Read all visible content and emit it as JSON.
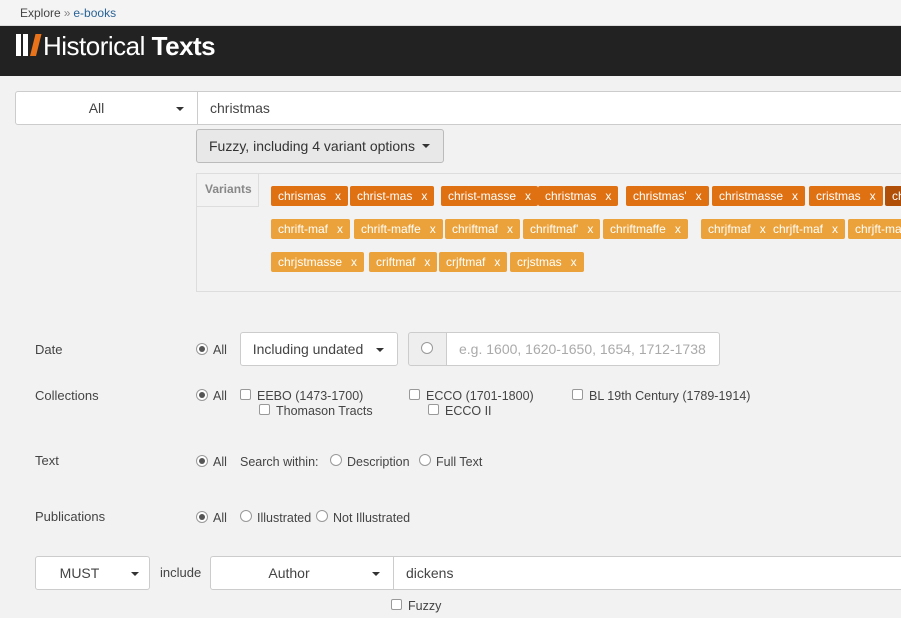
{
  "breadcrumb": {
    "explore": "Explore",
    "separator": "»",
    "current": "e-books"
  },
  "brand": {
    "name_light": "Historical",
    "name_bold": "Texts"
  },
  "search": {
    "scope": "All",
    "query": "christmas",
    "fuzzy_label": "Fuzzy, including 4 variant options"
  },
  "variants": {
    "label": "Variants",
    "remove_glyph": "x",
    "row1": [
      "chrismas",
      "christ-mas",
      "christ-masse",
      "christmas",
      "christmas'",
      "christmasse",
      "cristmas",
      "ch"
    ],
    "row2": [
      "chrift-maf",
      "chrift-maffe",
      "chriftmaf",
      "chriftmaf'",
      "chriftmaffe",
      "chrjfmaf",
      "chrjft-maf",
      "chrjft-ma"
    ],
    "row3": [
      "chrjstmasse",
      "criftmaf",
      "crjftmaf",
      "crjstmas"
    ]
  },
  "filters": {
    "date": {
      "label": "Date",
      "all": "All",
      "undated_option": "Including undated",
      "placeholder": "e.g. 1600, 1620-1650, 1654, 1712-1738"
    },
    "collections": {
      "label": "Collections",
      "all": "All",
      "items": [
        "EEBO (1473-1700)",
        "Thomason Tracts",
        "ECCO (1701-1800)",
        "ECCO II",
        "BL 19th Century (1789-1914)"
      ]
    },
    "text": {
      "label": "Text",
      "all": "All",
      "search_within": "Search within:",
      "description": "Description",
      "full_text": "Full Text"
    },
    "publications": {
      "label": "Publications",
      "all": "All",
      "illustrated": "Illustrated",
      "not_illustrated": "Not Illustrated"
    }
  },
  "author_row": {
    "operator": "MUST",
    "include": "include",
    "field": "Author",
    "value": "dickens",
    "fuzzy": "Fuzzy"
  },
  "colors": {
    "tag_primary": "#e07113",
    "tag_variant": "#eba23a",
    "tag_selected": "#b04f07",
    "header": "#222222"
  }
}
